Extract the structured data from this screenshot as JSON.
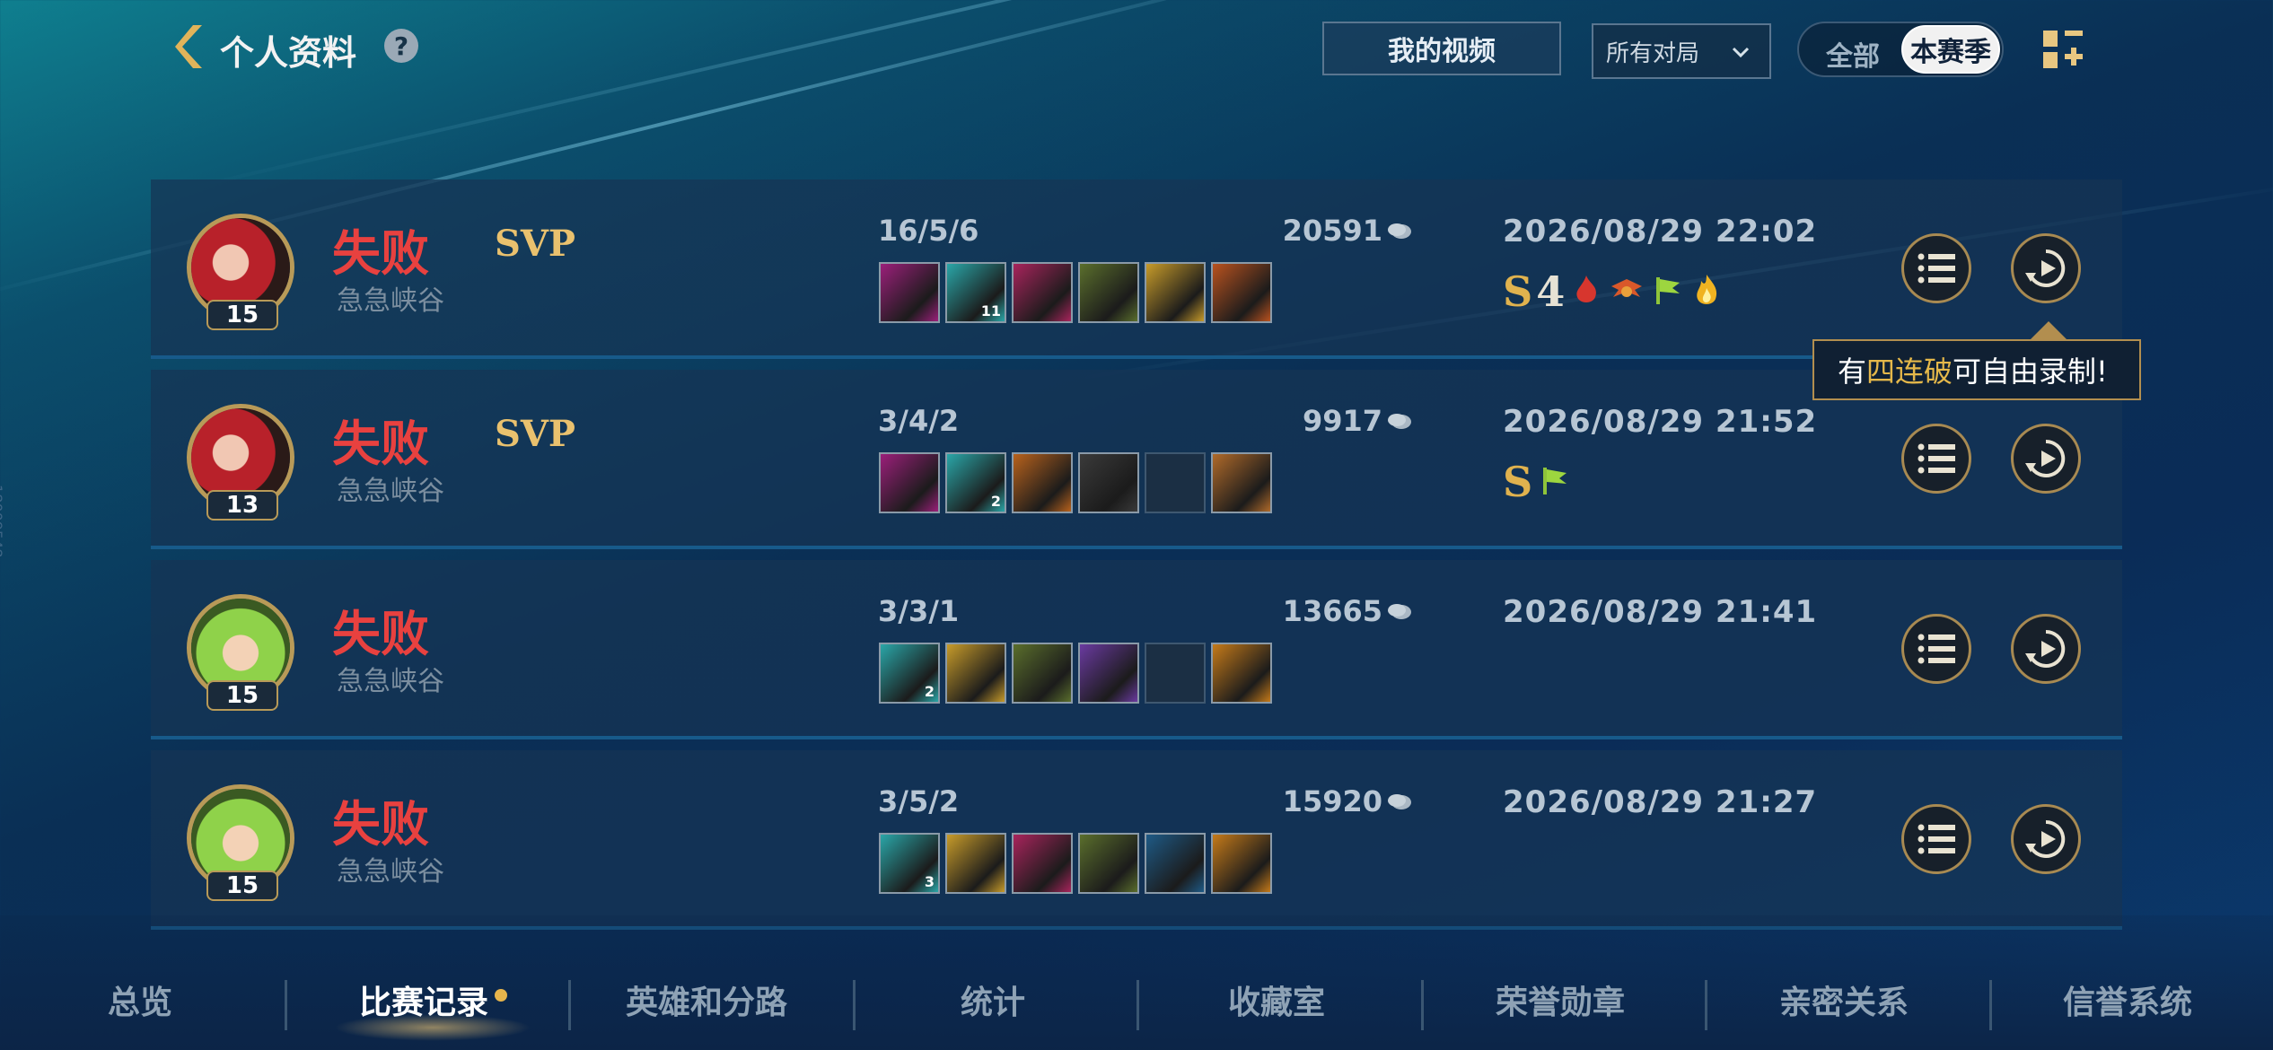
{
  "header": {
    "title": "个人资料",
    "help_label": "?",
    "video_button": "我的视频",
    "filter_selected": "所有对局",
    "toggle_all": "全部",
    "toggle_season": "本赛季"
  },
  "side_id": "18009548",
  "tooltip": {
    "prefix": "有",
    "highlight": "四连破",
    "suffix": "可自由录制!"
  },
  "matches": [
    {
      "level": "15",
      "result": "失败",
      "mode": "急急峡谷",
      "svp": "SVP",
      "kda": "16/5/6",
      "gold": "20591",
      "date": "2026/08/29 22:02",
      "items": [
        {
          "c": "#9b1f7a"
        },
        {
          "c": "#2aa6a8",
          "n": "11"
        },
        {
          "c": "#a8245c"
        },
        {
          "c": "#5a6e2c"
        },
        {
          "c": "#c79b2a"
        },
        {
          "c": "#b9521f"
        }
      ],
      "badges": [
        "S",
        "4",
        "flame-red",
        "wings-red",
        "flag-green",
        "fire-gold"
      ]
    },
    {
      "level": "13",
      "result": "失败",
      "mode": "急急峡谷",
      "svp": "SVP",
      "kda": "3/4/2",
      "gold": "9917",
      "date": "2026/08/29 21:52",
      "items": [
        {
          "c": "#9b1f7a"
        },
        {
          "c": "#2aa6a8",
          "n": "2"
        },
        {
          "c": "#b8621c"
        },
        {
          "c": "#3a3a3a"
        },
        {
          "c": "empty"
        },
        {
          "c": "#b06a2a"
        }
      ],
      "badges": [
        "S",
        "flag-green"
      ]
    },
    {
      "level": "15",
      "result": "失败",
      "mode": "急急峡谷",
      "svp": "",
      "kda": "3/3/1",
      "gold": "13665",
      "date": "2026/08/29 21:41",
      "items": [
        {
          "c": "#2aa6a8",
          "n": "2"
        },
        {
          "c": "#c79b2a"
        },
        {
          "c": "#5a6e2c"
        },
        {
          "c": "#6a3aa0"
        },
        {
          "c": "empty"
        },
        {
          "c": "#c57a1a"
        }
      ],
      "badges": []
    },
    {
      "level": "15",
      "result": "失败",
      "mode": "急急峡谷",
      "svp": "",
      "kda": "3/5/2",
      "gold": "15920",
      "date": "2026/08/29 21:27",
      "items": [
        {
          "c": "#2aa6a8",
          "n": "3"
        },
        {
          "c": "#c79b2a"
        },
        {
          "c": "#a8245c"
        },
        {
          "c": "#5a6e2c"
        },
        {
          "c": "#1e5a86"
        },
        {
          "c": "#c57a1a"
        }
      ],
      "badges": []
    }
  ],
  "nav": [
    "总览",
    "比赛记录",
    "英雄和分路",
    "统计",
    "收藏室",
    "荣誉勋章",
    "亲密关系",
    "信誉系统"
  ],
  "colors": {
    "defeat": "#e8413f",
    "svp": "#e9c16e",
    "accent_gold": "#b89a58"
  }
}
